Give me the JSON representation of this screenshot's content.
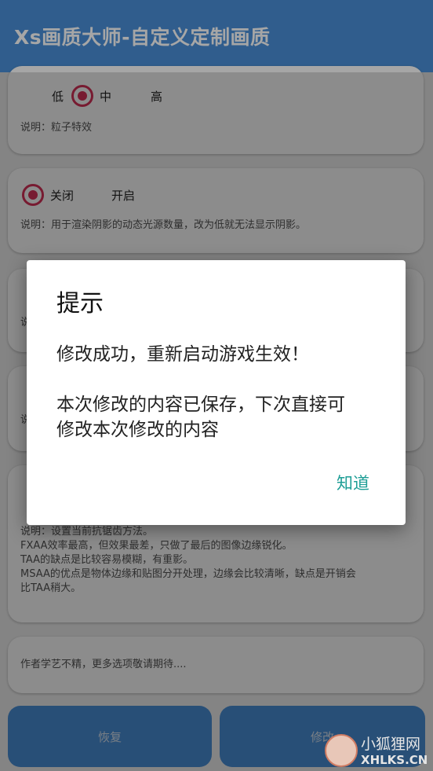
{
  "app_bar": {
    "title": "Xs画质大师-自定义定制画质"
  },
  "cards": {
    "particles": {
      "options": [
        "低",
        "中",
        "高"
      ],
      "selected": "低",
      "description": "说明：粒子特效"
    },
    "shadows": {
      "options": [
        "关闭",
        "开启"
      ],
      "selected": "关闭",
      "description": "说明：用于渲染阴影的动态光源数量，改为低就无法显示阴影。"
    },
    "hidden_a": {
      "description": "说"
    },
    "hidden_b": {
      "description": "说"
    },
    "antialias": {
      "description_lines": [
        "说明：设置当前抗锯齿方法。",
        "FXAA效率最高，但效果最差，只做了最后的图像边缘锐化。",
        "TAA的缺点是比较容易模糊，有重影。",
        "MSAA的优点是物体边缘和贴图分开处理，边缘会比较清晰，缺点是开销会",
        "比TAA稍大。"
      ]
    },
    "footer_note": {
      "description": "作者学艺不精，更多选项敬请期待...."
    }
  },
  "buttons": {
    "reset": "恢复",
    "modify": "修改"
  },
  "dialog": {
    "title": "提示",
    "message_1": "修改成功，重新启动游戏生效！",
    "message_2_line1": "本次修改的内容已保存，下次直接可",
    "message_2_line2": "修改本次修改的内容",
    "ok_label": "知道"
  },
  "watermark": {
    "text": "小狐狸网",
    "url": "XHLKS.CN"
  },
  "colors": {
    "primary": "#4a90d9",
    "radio": "#d9325a",
    "dialog_action": "#1e9e96"
  }
}
